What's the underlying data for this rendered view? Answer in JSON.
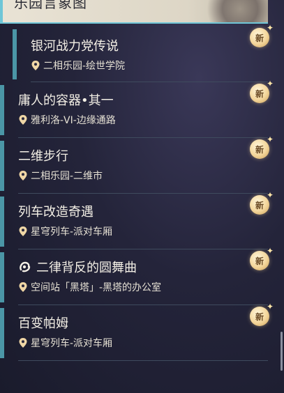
{
  "header": {
    "title": "乐园言象图"
  },
  "quests": [
    {
      "name": "银河战力党传说",
      "location": "二相乐园-绘世学院",
      "badge": "新"
    },
    {
      "name": "庸人的容器•其一",
      "location": "雅利洛-VI-边缘通路",
      "badge": "新"
    },
    {
      "name": "二维步行",
      "location": "二相乐园-二维市",
      "badge": "新"
    },
    {
      "name": "列车改造奇遇",
      "location": "星穹列车-派对车厢",
      "badge": "新"
    },
    {
      "name": "二律背反的圆舞曲",
      "location": "空间站「黑塔」-黑塔的办公室",
      "badge": "新",
      "icon": "quest-glyph-icon"
    },
    {
      "name": "百变帕姆",
      "location": "星穹列车-派对车厢",
      "badge": "新"
    }
  ],
  "colors": {
    "accent": "#6fc6d7",
    "bar": "#4b96a6",
    "badge": "#f3d59a"
  }
}
